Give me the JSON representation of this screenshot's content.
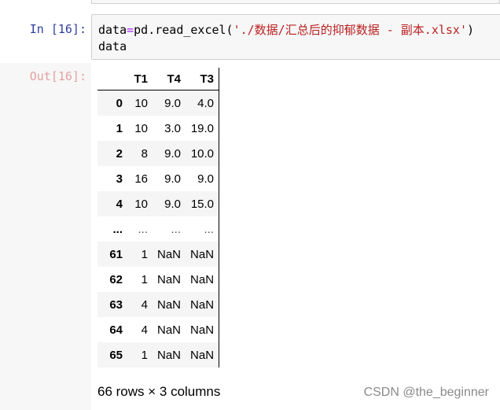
{
  "input_cell": {
    "prompt": "In  [16]:",
    "code_line1_var": "data",
    "code_line1_op": "=",
    "code_line1_call": "pd.read_excel(",
    "code_line1_str": "'./数据/汇总后的抑郁数据 - 副本.xlsx'",
    "code_line1_close": ")",
    "code_line2": "data"
  },
  "output_cell": {
    "prompt": "Out[16]:",
    "columns": [
      "",
      "T1",
      "T4",
      "T3"
    ],
    "rows": [
      {
        "index": "0",
        "T1": "10",
        "T4": "9.0",
        "T3": "4.0"
      },
      {
        "index": "1",
        "T1": "10",
        "T4": "3.0",
        "T3": "19.0"
      },
      {
        "index": "2",
        "T1": "8",
        "T4": "9.0",
        "T3": "10.0"
      },
      {
        "index": "3",
        "T1": "16",
        "T4": "9.0",
        "T3": "9.0"
      },
      {
        "index": "4",
        "T1": "10",
        "T4": "9.0",
        "T3": "15.0"
      },
      {
        "index": "...",
        "T1": "...",
        "T4": "...",
        "T3": "..."
      },
      {
        "index": "61",
        "T1": "1",
        "T4": "NaN",
        "T3": "NaN"
      },
      {
        "index": "62",
        "T1": "1",
        "T4": "NaN",
        "T3": "NaN"
      },
      {
        "index": "63",
        "T1": "4",
        "T4": "NaN",
        "T3": "NaN"
      },
      {
        "index": "64",
        "T1": "4",
        "T4": "NaN",
        "T3": "NaN"
      },
      {
        "index": "65",
        "T1": "1",
        "T4": "NaN",
        "T3": "NaN"
      }
    ],
    "summary": "66 rows × 3 columns"
  },
  "watermark": "CSDN @the_beginner",
  "colors": {
    "in_prompt": "#303f9f",
    "out_prompt": "#e4a0a0",
    "string": "#ba2121",
    "operator": "#aa22ff",
    "cell_bg": "#f7f7f7"
  }
}
